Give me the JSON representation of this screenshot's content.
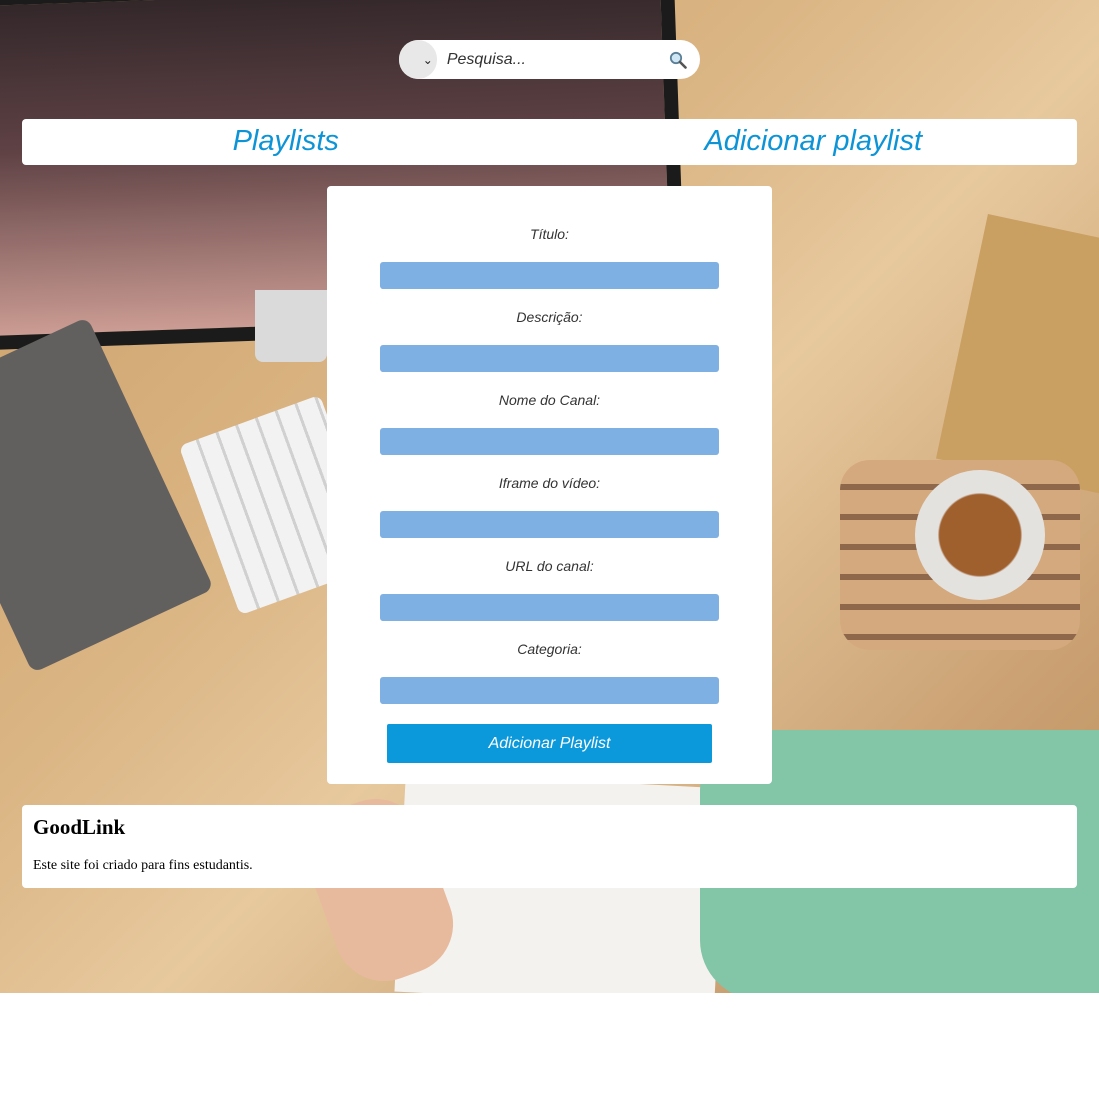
{
  "search": {
    "placeholder": "Pesquisa...",
    "icon": "magnifier-icon"
  },
  "nav": {
    "playlists": "Playlists",
    "add_playlist": "Adicionar playlist"
  },
  "form": {
    "fields": [
      {
        "label": "Título:",
        "value": ""
      },
      {
        "label": "Descrição:",
        "value": ""
      },
      {
        "label": "Nome do Canal:",
        "value": ""
      },
      {
        "label": "Iframe do vídeo:",
        "value": ""
      },
      {
        "label": "URL do canal:",
        "value": ""
      },
      {
        "label": "Categoria:",
        "value": ""
      }
    ],
    "submit_label": "Adicionar Playlist"
  },
  "footer": {
    "title": "GoodLink",
    "text": "Este site foi criado para fins estudantis."
  },
  "colors": {
    "accent": "#0d94d6",
    "input_bg": "#7eb0e3",
    "button_bg": "#0b99dc"
  }
}
